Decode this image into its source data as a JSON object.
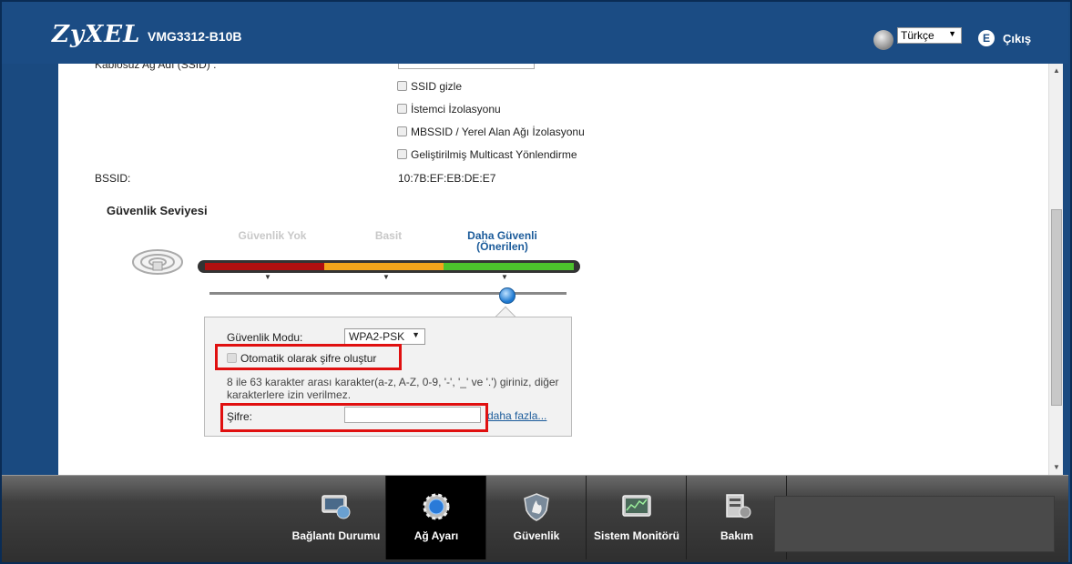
{
  "header": {
    "brand": "ZyXEL",
    "model": "VMG3312-B10B",
    "language": "Türkçe",
    "logout_label": "Çıkış"
  },
  "wireless": {
    "ssid_label": "Kablosuz Ağ Adı (SSID) :",
    "options": [
      {
        "label": "SSID gizle",
        "checked": false
      },
      {
        "label": "İstemci İzolasyonu",
        "checked": false
      },
      {
        "label": "MBSSID / Yerel Alan Ağı İzolasyonu",
        "checked": false
      },
      {
        "label": "Geliştirilmiş Multicast Yönlendirme",
        "checked": false
      }
    ],
    "bssid_label": "BSSID:",
    "bssid_value": "10:7B:EF:EB:DE:E7"
  },
  "security": {
    "title": "Güvenlik Seviyesi",
    "levels": [
      {
        "name": "Güvenlik Yok",
        "color": "#b01010"
      },
      {
        "name": "Basit",
        "color": "#f3a51b"
      },
      {
        "name": "Daha Güvenli",
        "note": "(Önerilen)",
        "color": "#4cc22c"
      }
    ],
    "selected_level_index": 2,
    "mode_label": "Güvenlik Modu:",
    "mode_value": "WPA2-PSK",
    "auto_password_label": "Otomatik olarak şifre oluştur",
    "auto_password_checked": false,
    "hint": "8 ile 63 karakter arası karakter(a-z, A-Z, 0-9, '-', '_' ve '.') giriniz, diğer karakterlere izin verilmez.",
    "password_label": "Şifre:",
    "password_value": "",
    "more_link": "daha fazla..."
  },
  "nav": {
    "items": [
      {
        "label": "Bağlantı Durumu",
        "icon": "monitor-globe-icon",
        "active": false
      },
      {
        "label": "Ağ Ayarı",
        "icon": "gear-globe-icon",
        "active": true
      },
      {
        "label": "Güvenlik",
        "icon": "shield-icon",
        "active": false
      },
      {
        "label": "Sistem Monitörü",
        "icon": "chart-monitor-icon",
        "active": false
      },
      {
        "label": "Bakım",
        "icon": "maintenance-icon",
        "active": false
      }
    ]
  },
  "colors": {
    "header_bg": "#1b4c84",
    "highlight": "#e01010",
    "link": "#1b5b9a"
  }
}
